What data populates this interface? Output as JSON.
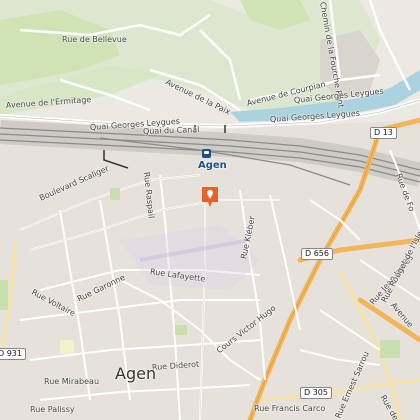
{
  "map": {
    "city_name": "Agen",
    "station_name": "Agen",
    "marker": {
      "name": "location-marker",
      "color": "#e8612c"
    },
    "road_shields": [
      "D 13",
      "D 656",
      "D 305",
      "D 931"
    ],
    "streets": {
      "rue_bellevue": "Rue de Bellevue",
      "chemin_fourche_pont": "Chemin de la Fourche Pont",
      "avenue_courpian": "Avenue de Courpian",
      "avenue_de_la_paix": "Avenue de la Paix",
      "quai_georges_leygues_top": "Quai Georges Leygues",
      "avenue_ermitage": "Avenue de l'Ermitage",
      "quai_georges_leygues": "Quai Georges Leygues",
      "quai_georges_leygues_right": "Quai Georges Leygues",
      "quai_du_canal": "Quai du Canal",
      "boulevard_scaliger": "Boulevard Scaliger",
      "rue_raspail": "Rue Raspail",
      "rue_lafayette": "Rue Lafayette",
      "rue_voltaire": "Rue Voltaire",
      "rue_garonne": "Rue Garonne",
      "rue_kleber": "Rue Kléber",
      "cours_victor_hugo": "Cours Victor Hugo",
      "rue_diderot": "Rue Diderot",
      "rue_mirabeau": "Rue Mirabeau",
      "rue_palissy": "Rue Palissy",
      "rue_francis_carco": "Rue Francis Carco",
      "rue_ernest_sarrou": "Rue Ernest Sarrou",
      "rue_jean_jaures": "Rue Jean Jaurès",
      "rue_rougets_isle": "Rue Rouget de l'Isle",
      "avenue_right": "Avenue",
      "rue_de_bordeaux": "Rue de Bor",
      "rue_right_top": "Rue de Fo"
    },
    "colors": {
      "background": "#f2efe9",
      "forest": "#cfe3b4",
      "water": "#aad3df",
      "railway": "#8a8a8a",
      "major_road": "#f3b55a",
      "minor_road": "#ffffff",
      "station": "#1a4f8a"
    }
  }
}
